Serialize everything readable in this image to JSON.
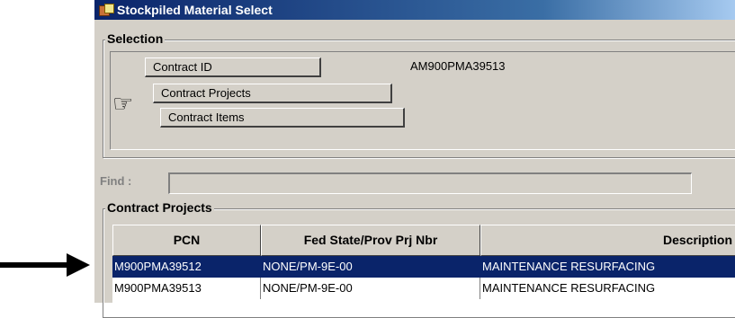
{
  "window": {
    "title": "Stockpiled Material Select"
  },
  "selection": {
    "label": "Selection",
    "contract_id_label": "Contract ID",
    "contract_id_value": "AM900PMA39513",
    "contract_projects_label": "Contract Projects",
    "contract_items_label": "Contract Items"
  },
  "find": {
    "label": "Find :",
    "value": ""
  },
  "projects": {
    "label": "Contract Projects",
    "columns": [
      "PCN",
      "Fed State/Prov Prj Nbr",
      "Description"
    ],
    "rows": [
      {
        "pcn": "M900PMA39512",
        "fed": "NONE/PM-9E-00",
        "desc": "MAINTENANCE RESURFACING",
        "selected": true
      },
      {
        "pcn": "M900PMA39513",
        "fed": "NONE/PM-9E-00",
        "desc": "MAINTENANCE RESURFACING",
        "selected": false
      }
    ]
  },
  "colors": {
    "titlebar": "#0a246a",
    "selected_row": "#0a246a",
    "face": "#d4d0c8"
  }
}
